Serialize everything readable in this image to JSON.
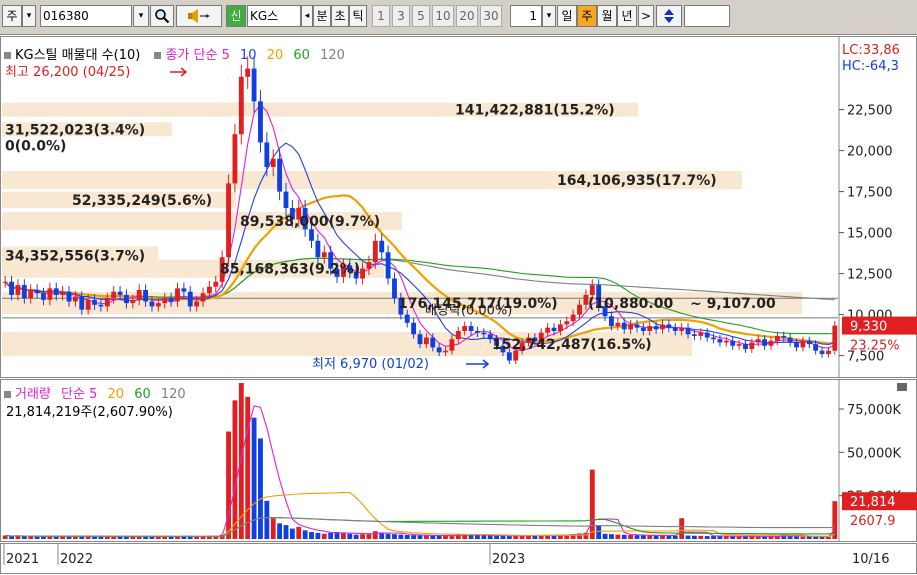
{
  "toolbar": {
    "type_label": "주",
    "code_value": "016380",
    "new_label": "신",
    "stock_name": "KG스",
    "fen_label": "분",
    "cho_label": "초",
    "tick_label": "틱",
    "intervals": [
      "1",
      "3",
      "5",
      "10",
      "20",
      "30"
    ],
    "count_value": "1",
    "day_label": "일",
    "week_label": "주",
    "month_label": "월",
    "year_label": "년",
    "next_label": ">",
    "updown_icon": "updown-arrow-icon",
    "search_icon": "magnifier-icon",
    "sound_icon": "speaker-icon"
  },
  "price_panel": {
    "legend_name": "KG스틸 매물대 수(10)",
    "legend_ma": "종가 단순",
    "ma_periods": [
      "5",
      "10",
      "20",
      "60",
      "120"
    ],
    "ma_colors": [
      "#e020e0",
      "#2040e0",
      "#f0a000",
      "#20a020",
      "#808080"
    ],
    "lc_label": "LC:33,86",
    "hc_label": "HC:-64,3",
    "high_label": "최고 26,200 (04/25)",
    "low_label": "최저 6,970 (01/02)",
    "current_price": "9,330",
    "change_pct": "23.25%",
    "dividend_label": "배당락(0.00%)",
    "range_label": "~ 9,107.00",
    "volume_profile": [
      "141,422,881(15.2%)",
      "31,522,023(3.4%)",
      "0(0.0%)",
      "164,106,935(17.7%)",
      "52,335,249(5.6%)",
      "89,538,000(9.7%)",
      "34,352,556(3.7%)",
      "85,168,363(9.2%)",
      "176,145,717(19.0%)",
      "152,742,487(16.5%)",
      "(10,880.00"
    ],
    "y_ticks": [
      "22,500",
      "20,000",
      "17,500",
      "15,000",
      "12,500",
      "10,000",
      "7,500"
    ]
  },
  "volume_panel": {
    "legend_name": "거래량",
    "legend_ma": "단순",
    "ma_periods": [
      "5",
      "20",
      "60",
      "120"
    ],
    "ma_colors": [
      "#e020e0",
      "#f0a000",
      "#20a020",
      "#808080"
    ],
    "volume_info": "21,814,219주(2,607.90%)",
    "current_volume": "21,814",
    "volume_pct": "2607.9",
    "y_ticks": [
      "75,000K",
      "50,000K",
      "25,000K"
    ]
  },
  "x_axis": {
    "labels": [
      "2021",
      "2022",
      "2023"
    ],
    "date_label": "10/16"
  },
  "chart_data": {
    "type": "candlestick",
    "ylim": [
      6500,
      26500
    ],
    "volume_ylim": [
      0,
      90000
    ],
    "weeks": 131,
    "close": [
      12000,
      11200,
      11800,
      11000,
      11500,
      11300,
      10900,
      11600,
      11200,
      11400,
      10800,
      11100,
      10300,
      10900,
      10600,
      10500,
      11000,
      11400,
      11200,
      10700,
      10900,
      11500,
      10800,
      10500,
      10700,
      11000,
      10800,
      11600,
      11400,
      10500,
      10800,
      11300,
      11700,
      12000,
      13500,
      18000,
      21000,
      24500,
      25000,
      23000,
      20500,
      19000,
      19500,
      17500,
      16500,
      15800,
      16500,
      15200,
      14500,
      13500,
      13800,
      12800,
      12300,
      13000,
      12600,
      12200,
      12800,
      13200,
      14500,
      13800,
      12200,
      11000,
      10000,
      9500,
      8800,
      8200,
      8600,
      8000,
      7700,
      7800,
      8500,
      9000,
      9300,
      9000,
      8900,
      8800,
      8500,
      8100,
      7700,
      7200,
      7800,
      8300,
      8600,
      8400,
      8900,
      9200,
      9000,
      9400,
      9600,
      10000,
      10600,
      11200,
      11800,
      10500,
      9900,
      9300,
      9500,
      9100,
      9400,
      9200,
      9000,
      9300,
      9100,
      9400,
      9200,
      9000,
      9200,
      8800,
      8700,
      8900,
      8600,
      8500,
      8300,
      8400,
      8100,
      8200,
      7900,
      8300,
      8500,
      8100,
      8400,
      8700,
      8600,
      8300,
      8000,
      8400,
      8200,
      7800,
      7600,
      7800,
      9330
    ],
    "volume": [
      2000,
      1500,
      1800,
      1600,
      1700,
      1400,
      1500,
      1600,
      1500,
      1700,
      1800,
      1600,
      1500,
      1400,
      1600,
      1500,
      1300,
      1400,
      1500,
      1400,
      1300,
      1500,
      1400,
      1300,
      1600,
      1500,
      1400,
      1500,
      1600,
      1500,
      1400,
      1500,
      1700,
      1800,
      2500,
      62000,
      80000,
      90000,
      82000,
      70000,
      58000,
      22000,
      12000,
      9000,
      8000,
      6000,
      7000,
      5000,
      4000,
      3500,
      3000,
      3500,
      4000,
      3500,
      3000,
      2500,
      2800,
      3200,
      4500,
      3800,
      3000,
      2800,
      2500,
      2300,
      2200,
      2000,
      2100,
      1900,
      1800,
      2000,
      2400,
      2600,
      2500,
      2300,
      2200,
      2100,
      2000,
      1900,
      1800,
      1700,
      1800,
      2000,
      2200,
      2100,
      2000,
      2300,
      2200,
      2400,
      2500,
      2800,
      3200,
      3600,
      40000,
      8000,
      3000,
      2800,
      2500,
      2400,
      2300,
      2200,
      2100,
      2000,
      2200,
      2100,
      2000,
      1900,
      12000,
      2000,
      1900,
      1800,
      1700,
      1800,
      1600,
      1700,
      1500,
      1600,
      1700,
      1500,
      1400,
      1600,
      1500,
      1400,
      3000,
      1500,
      1400,
      1300,
      1500,
      1400,
      1300,
      1200,
      21814
    ]
  }
}
